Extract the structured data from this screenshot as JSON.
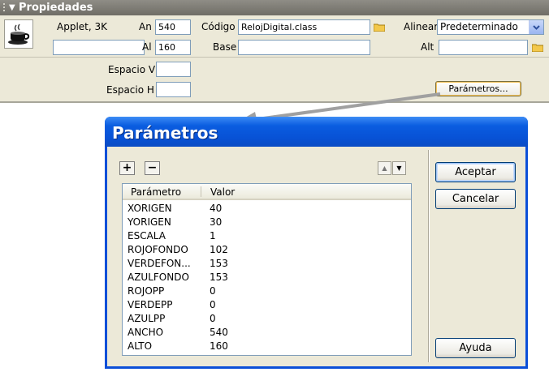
{
  "panel": {
    "title": "Propiedades",
    "applet_label": "Applet, 3K",
    "name_value": "",
    "an_label": "An",
    "an_value": "540",
    "al_label": "Al",
    "al_value": "160",
    "codigo_label": "Código",
    "codigo_value": "RelojDigital.class",
    "base_label": "Base",
    "base_value": "",
    "alinear_label": "Alinear",
    "alinear_value": "Predeterminado",
    "alt_label": "Alt",
    "alt_value": "",
    "espacio_v_label": "Espacio V",
    "espacio_v_value": "",
    "espacio_h_label": "Espacio H",
    "espacio_h_value": "",
    "parametros_button": "Parámetros..."
  },
  "dialog": {
    "title": "Parámetros",
    "add_symbol": "+",
    "remove_symbol": "−",
    "up_symbol": "▲",
    "down_symbol": "▼",
    "columns": [
      "Parámetro",
      "Valor"
    ],
    "rows": [
      {
        "name": "XORIGEN",
        "value": "40"
      },
      {
        "name": "YORIGEN",
        "value": "30"
      },
      {
        "name": "ESCALA",
        "value": "1"
      },
      {
        "name": "ROJOFONDO",
        "value": "102"
      },
      {
        "name": "VERDEFON...",
        "value": "153"
      },
      {
        "name": "AZULFONDO",
        "value": "153"
      },
      {
        "name": "ROJOPP",
        "value": "0"
      },
      {
        "name": "VERDEPP",
        "value": "0"
      },
      {
        "name": "AZULPP",
        "value": "0"
      },
      {
        "name": "ANCHO",
        "value": "540"
      },
      {
        "name": "ALTO",
        "value": "160"
      }
    ],
    "accept_button": "Aceptar",
    "cancel_button": "Cancelar",
    "help_button": "Ayuda"
  },
  "icons": {
    "applet": "coffee-cup-icon",
    "folder": "folder-icon",
    "dropdown": "chevron-down-icon",
    "collapse": "triangle-down-icon"
  },
  "colors": {
    "panel_bg": "#ece9d8",
    "titlebar": "#0a5de0",
    "header_bar": "#7d7b74"
  }
}
